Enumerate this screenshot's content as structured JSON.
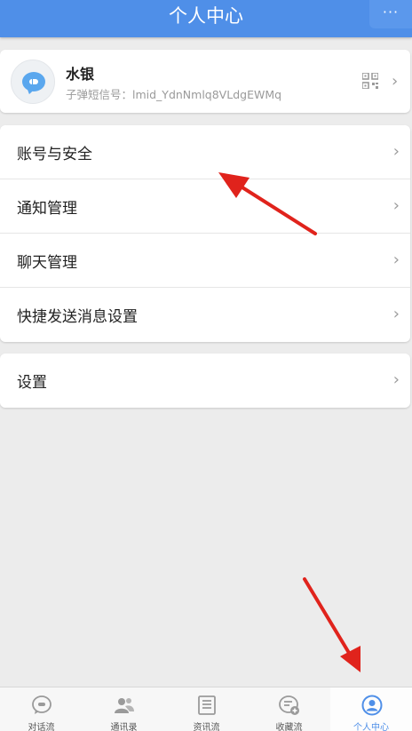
{
  "header": {
    "title": "个人中心",
    "more_label": "···"
  },
  "profile": {
    "name": "水银",
    "id_text": "子弹短信号：lmid_YdnNmlq8VLdgEWMq",
    "avatar_icon": "chat-bubble-icon",
    "qr_icon": "qr-code-icon"
  },
  "menu_group_1": {
    "items": [
      {
        "label": "账号与安全"
      },
      {
        "label": "通知管理"
      },
      {
        "label": "聊天管理"
      },
      {
        "label": "快捷发送消息设置"
      }
    ]
  },
  "menu_group_2": {
    "items": [
      {
        "label": "设置"
      }
    ]
  },
  "bottom_nav": {
    "items": [
      {
        "label": "对话流",
        "icon": "chat-bubble-icon"
      },
      {
        "label": "通讯录",
        "icon": "contacts-icon"
      },
      {
        "label": "资讯流",
        "icon": "news-icon"
      },
      {
        "label": "收藏流",
        "icon": "favorites-icon"
      },
      {
        "label": "个人中心",
        "icon": "profile-icon"
      }
    ],
    "active_index": 4
  },
  "colors": {
    "accent": "#4f8fe8",
    "annotation_arrow": "#e0231c",
    "background": "#ececec"
  }
}
